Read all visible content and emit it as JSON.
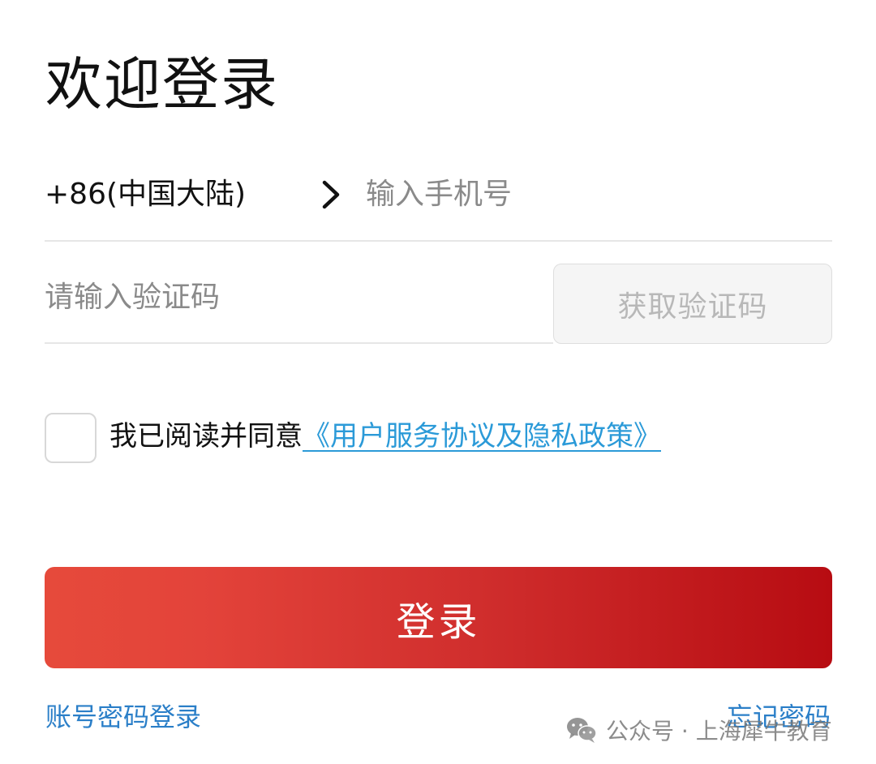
{
  "page": {
    "title": "欢迎登录"
  },
  "phone": {
    "country_code": "+86(中国大陆)",
    "placeholder": "输入手机号",
    "value": ""
  },
  "verification": {
    "placeholder": "请输入验证码",
    "value": "",
    "get_code_label": "获取验证码"
  },
  "agreement": {
    "checked": false,
    "text": "我已阅读并同意",
    "link_text": "《用户服务协议及隐私政策》"
  },
  "actions": {
    "login_label": "登录",
    "account_login_label": "账号密码登录",
    "forgot_password_label": "忘记密码"
  },
  "watermark": {
    "text": "公众号 · 上海犀牛教育"
  },
  "icons": {
    "chevron": "chevron-right-icon",
    "wechat": "wechat-icon"
  },
  "colors": {
    "accent_red": "#e3433a",
    "accent_red_dark": "#b70c12",
    "link_blue": "#2b9ad8",
    "bottom_link_blue": "#2b7fc8"
  }
}
